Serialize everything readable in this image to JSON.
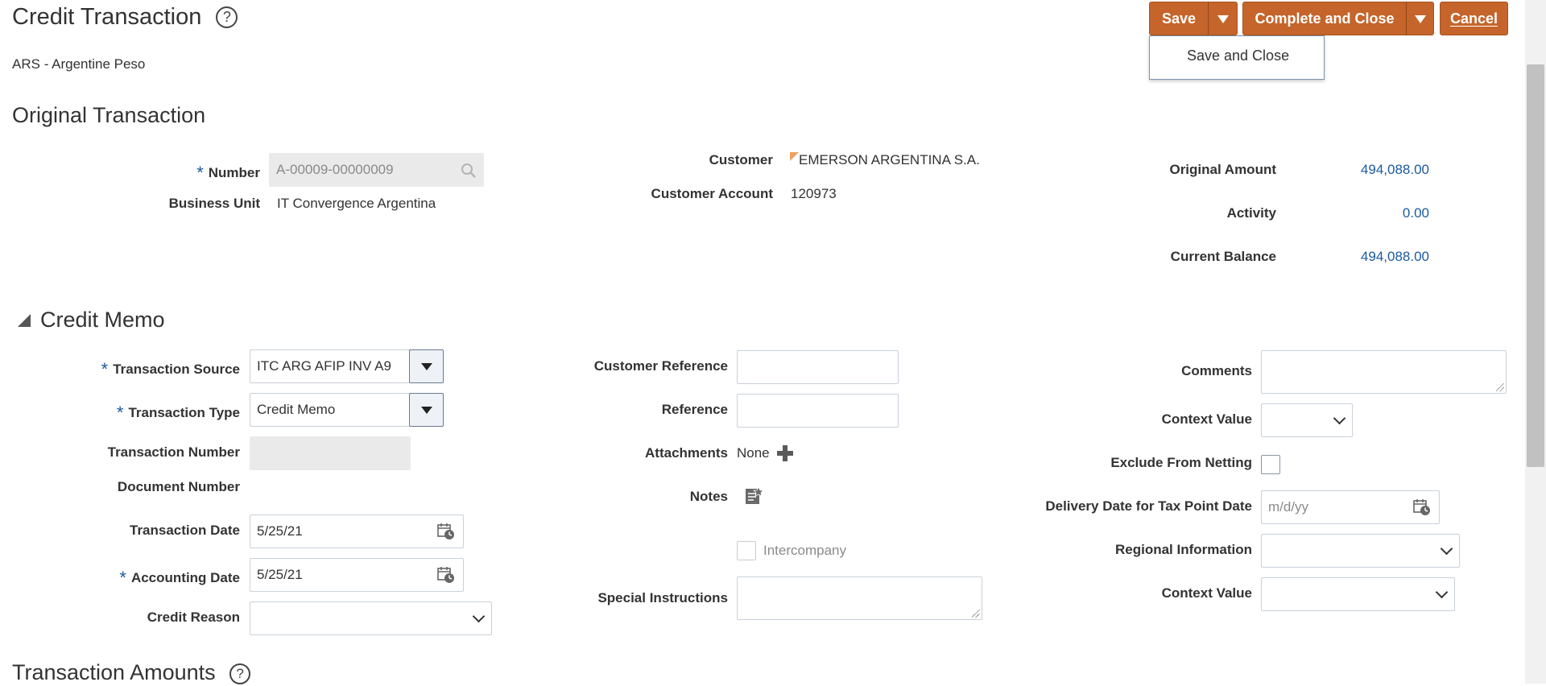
{
  "header": {
    "title": "Credit Transaction",
    "help_icon": "question-circle-icon",
    "currency_code": "ARS",
    "currency_sep": " - ",
    "currency_name": "Argentine Peso"
  },
  "toolbar": {
    "save_label": "Save",
    "complete_close_label": "Complete and Close",
    "cancel_label": "Cancel",
    "menu_save_close": "Save and Close",
    "accent_color": "#c5652b"
  },
  "original": {
    "section_title": "Original Transaction",
    "number_label": "Number",
    "number_value": "A-00009-00000009",
    "business_unit_label": "Business Unit",
    "business_unit_value": "IT Convergence Argentina",
    "customer_label": "Customer",
    "customer_value": "EMERSON ARGENTINA S.A.",
    "customer_account_label": "Customer Account",
    "customer_account_value": "120973",
    "original_amount_label": "Original Amount",
    "original_amount_value": "494,088.00",
    "activity_label": "Activity",
    "activity_value": "0.00",
    "current_balance_label": "Current Balance",
    "current_balance_value": "494,088.00"
  },
  "credit_memo": {
    "section_title": "Credit Memo",
    "transaction_source_label": "Transaction Source",
    "transaction_source_value": "ITC ARG AFIP INV A9",
    "transaction_type_label": "Transaction Type",
    "transaction_type_value": "Credit Memo",
    "transaction_number_label": "Transaction Number",
    "document_number_label": "Document Number",
    "transaction_date_label": "Transaction Date",
    "transaction_date_value": "5/25/21",
    "accounting_date_label": "Accounting Date",
    "accounting_date_value": "5/25/21",
    "credit_reason_label": "Credit Reason",
    "customer_reference_label": "Customer Reference",
    "reference_label": "Reference",
    "attachments_label": "Attachments",
    "attachments_value": "None",
    "notes_label": "Notes",
    "intercompany_label": "Intercompany",
    "special_instructions_label": "Special Instructions",
    "comments_label": "Comments",
    "context_value_label": "Context Value",
    "exclude_netting_label": "Exclude From Netting",
    "delivery_date_label": "Delivery Date for Tax Point Date",
    "delivery_date_placeholder": "m/d/yy",
    "regional_info_label": "Regional Information",
    "context_value2_label": "Context Value"
  },
  "amounts": {
    "section_title": "Transaction Amounts"
  }
}
